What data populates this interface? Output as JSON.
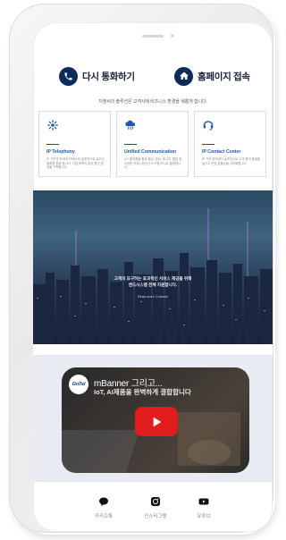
{
  "cta": {
    "call_label": "다시 통화하기",
    "home_label": "홈페이지 접속"
  },
  "intro_text": "지엔씨의 솔루션은 고객사에 비즈니스 환경을 새롭게 합니다.",
  "services": [
    {
      "icon": "network-hub-icon",
      "title": "IP Telephony",
      "description": "IP 기반의 차세대 IPPBX와 솔루션으로 유무선 통화를 통합 합니다. 기업 최적의 음성 통신 환경을 구축합니다."
    },
    {
      "icon": "cloud-icon",
      "title": "Unified Communication",
      "description": "UC 플랫폼을 통해 음성, 영상, 메시지, 협업 등 다양한 커뮤니케이션 도구를 하나로 통합합니다."
    },
    {
      "icon": "headset-icon",
      "title": "IP Contact Center",
      "description": "IP 기반 컨택센터 솔루션으로 고객 응대 품질을 높이고 운영 효율성을 극대화합니다."
    }
  ],
  "hero": {
    "line1": "고객의 요구하는 효과적인 서비스 제공을 위해",
    "line2": "앤드시스템 전체 지원합니다.",
    "link": "Read more Channel"
  },
  "video": {
    "logo_text": "GnTel",
    "title": "mBanner 그리고...",
    "subtitle": "IoT, AI제품을 완벽하게 결합합니다"
  },
  "social": [
    {
      "icon": "kakaotalk-icon",
      "label": "카카오톡"
    },
    {
      "icon": "instagram-icon",
      "label": "인스타그램"
    },
    {
      "icon": "youtube-icon",
      "label": "유튜브"
    }
  ],
  "colors": {
    "navy": "#0d2a5c",
    "service_title": "#1e56b0",
    "youtube_red": "#e01c1c",
    "video_bg": "#e8ecf2"
  }
}
